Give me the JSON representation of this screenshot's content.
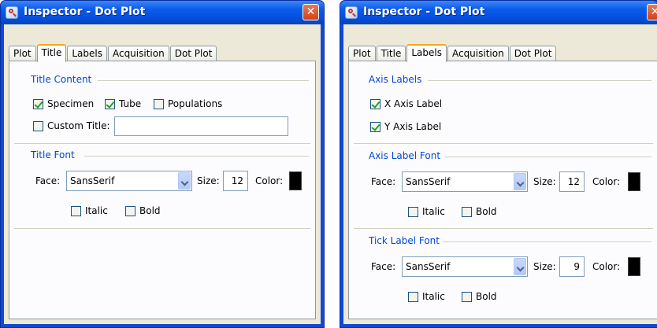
{
  "colors": {
    "titlebar": "#0b5cec",
    "group_title": "#0046d5",
    "check": "#21a121",
    "swatch_black": "#000000"
  },
  "left": {
    "title": "Inspector - Dot Plot",
    "icon": "magnifier-icon",
    "tabs": [
      "Plot",
      "Title",
      "Labels",
      "Acquisition",
      "Dot Plot"
    ],
    "active_tab": "Title",
    "title_content": {
      "heading": "Title Content",
      "specimen": {
        "label": "Specimen",
        "checked": true
      },
      "tube": {
        "label": "Tube",
        "checked": true
      },
      "populations": {
        "label": "Populations",
        "checked": false
      },
      "custom_title": {
        "label": "Custom Title:",
        "checked": false,
        "value": ""
      }
    },
    "title_font": {
      "heading": "Title Font",
      "face_label": "Face:",
      "face_value": "SansSerif",
      "size_label": "Size:",
      "size_value": "12",
      "color_label": "Color:",
      "color_value": "#000000",
      "italic": {
        "label": "Italic",
        "checked": false
      },
      "bold": {
        "label": "Bold",
        "checked": false
      }
    }
  },
  "right": {
    "title": "Inspector - Dot Plot",
    "icon": "magnifier-icon",
    "tabs": [
      "Plot",
      "Title",
      "Labels",
      "Acquisition",
      "Dot Plot"
    ],
    "active_tab": "Labels",
    "axis_labels": {
      "heading": "Axis Labels",
      "x_axis": {
        "label": "X Axis Label",
        "checked": true
      },
      "y_axis": {
        "label": "Y Axis Label",
        "checked": true
      }
    },
    "axis_label_font": {
      "heading": "Axis Label Font",
      "face_label": "Face:",
      "face_value": "SansSerif",
      "size_label": "Size:",
      "size_value": "12",
      "color_label": "Color:",
      "color_value": "#000000",
      "italic": {
        "label": "Italic",
        "checked": false
      },
      "bold": {
        "label": "Bold",
        "checked": false
      }
    },
    "tick_label_font": {
      "heading": "Tick Label Font",
      "face_label": "Face:",
      "face_value": "SansSerif",
      "size_label": "Size:",
      "size_value": "9",
      "color_label": "Color:",
      "color_value": "#000000",
      "italic": {
        "label": "Italic",
        "checked": false
      },
      "bold": {
        "label": "Bold",
        "checked": false
      }
    }
  }
}
